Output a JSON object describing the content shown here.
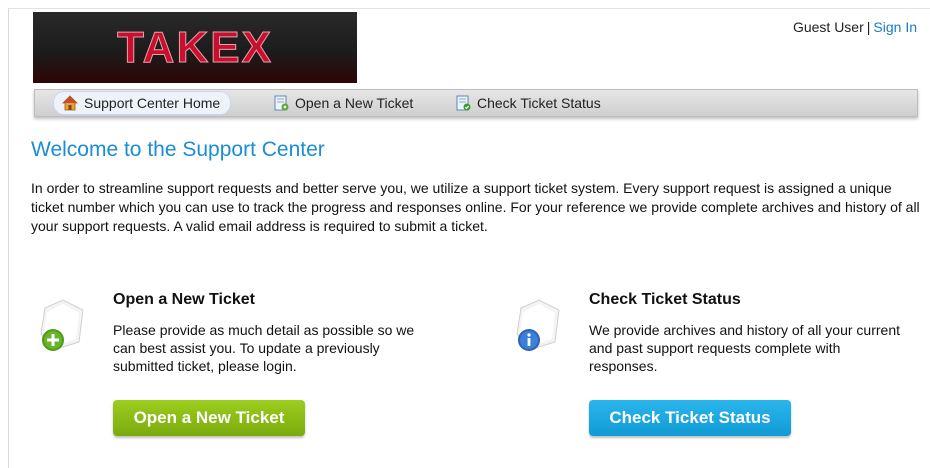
{
  "header": {
    "logo_text": "TAKEX",
    "user_label": "Guest User",
    "separator": "|",
    "signin_label": "Sign In"
  },
  "nav": {
    "items": [
      {
        "label": "Support Center Home",
        "icon": "home-icon"
      },
      {
        "label": "Open a New Ticket",
        "icon": "new-ticket-icon"
      },
      {
        "label": "Check Ticket Status",
        "icon": "ticket-status-icon"
      }
    ]
  },
  "main": {
    "title": "Welcome to the Support Center",
    "intro": "In order to streamline support requests and better serve you, we utilize a support ticket system. Every support request is assigned a unique ticket number which you can use to track the progress and responses online. For your reference we provide complete archives and history of all your support requests. A valid email address is required to submit a ticket."
  },
  "open_ticket": {
    "heading": "Open a New Ticket",
    "text": "Please provide as much detail as possible so we can best assist you. To update a previously submitted ticket, please login.",
    "button_label": "Open a New Ticket",
    "icon": "add-ticket-icon"
  },
  "check_status": {
    "heading": "Check Ticket Status",
    "text": "We provide archives and history of all your current and past support requests complete with responses.",
    "button_label": "Check Ticket Status",
    "icon": "info-ticket-icon"
  },
  "colors": {
    "accent": "#1a8ed1",
    "link": "#1a7fc1",
    "green_button": "#8bbf16",
    "blue_button": "#1ba8e2",
    "logo_red": "#c8102e"
  }
}
